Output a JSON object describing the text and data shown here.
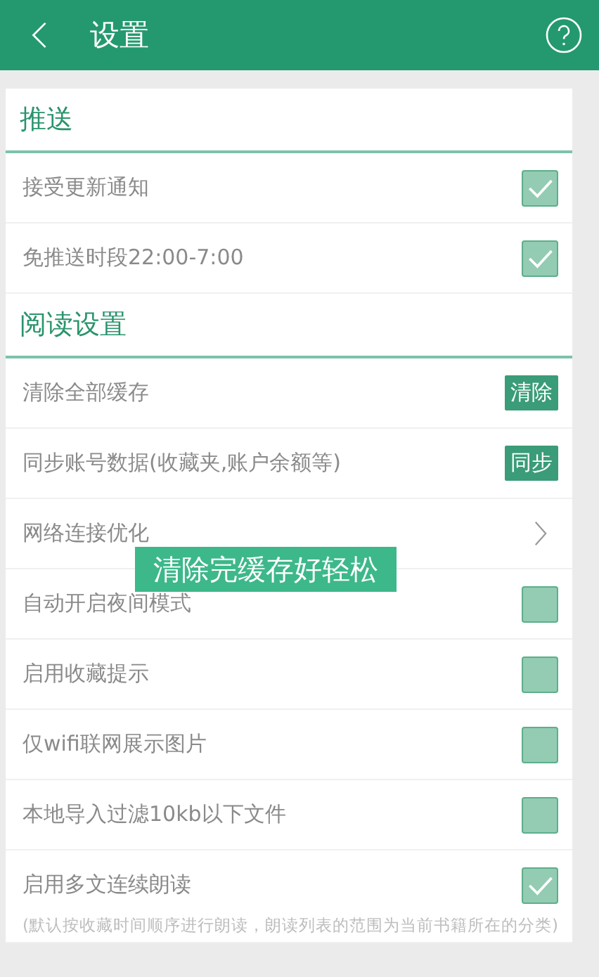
{
  "header": {
    "title": "设置"
  },
  "sections": [
    {
      "title": "推送",
      "items": [
        {
          "kind": "checkbox",
          "label": "接受更新通知",
          "checked": true
        },
        {
          "kind": "checkbox",
          "label": "免推送时段22:00-7:00",
          "checked": true
        }
      ]
    },
    {
      "title": "阅读设置",
      "items": [
        {
          "kind": "button",
          "label": "清除全部缓存",
          "button": "清除"
        },
        {
          "kind": "button",
          "label": "同步账号数据(收藏夹,账户余额等)",
          "button": "同步"
        },
        {
          "kind": "link",
          "label": "网络连接优化"
        },
        {
          "kind": "checkbox",
          "label": "自动开启夜间模式",
          "checked": false
        },
        {
          "kind": "checkbox",
          "label": "启用收藏提示",
          "checked": false
        },
        {
          "kind": "checkbox",
          "label": "仅wifi联网展示图片",
          "checked": false
        },
        {
          "kind": "checkbox",
          "label": "本地导入过滤10kb以下文件",
          "checked": false
        },
        {
          "kind": "checkbox",
          "label": "启用多文连续朗读",
          "checked": true,
          "note": "(默认按收藏时间顺序进行朗读，朗读列表的范围为当前书籍所在的分类)"
        }
      ]
    }
  ],
  "toast": "清除完缓存好轻松"
}
